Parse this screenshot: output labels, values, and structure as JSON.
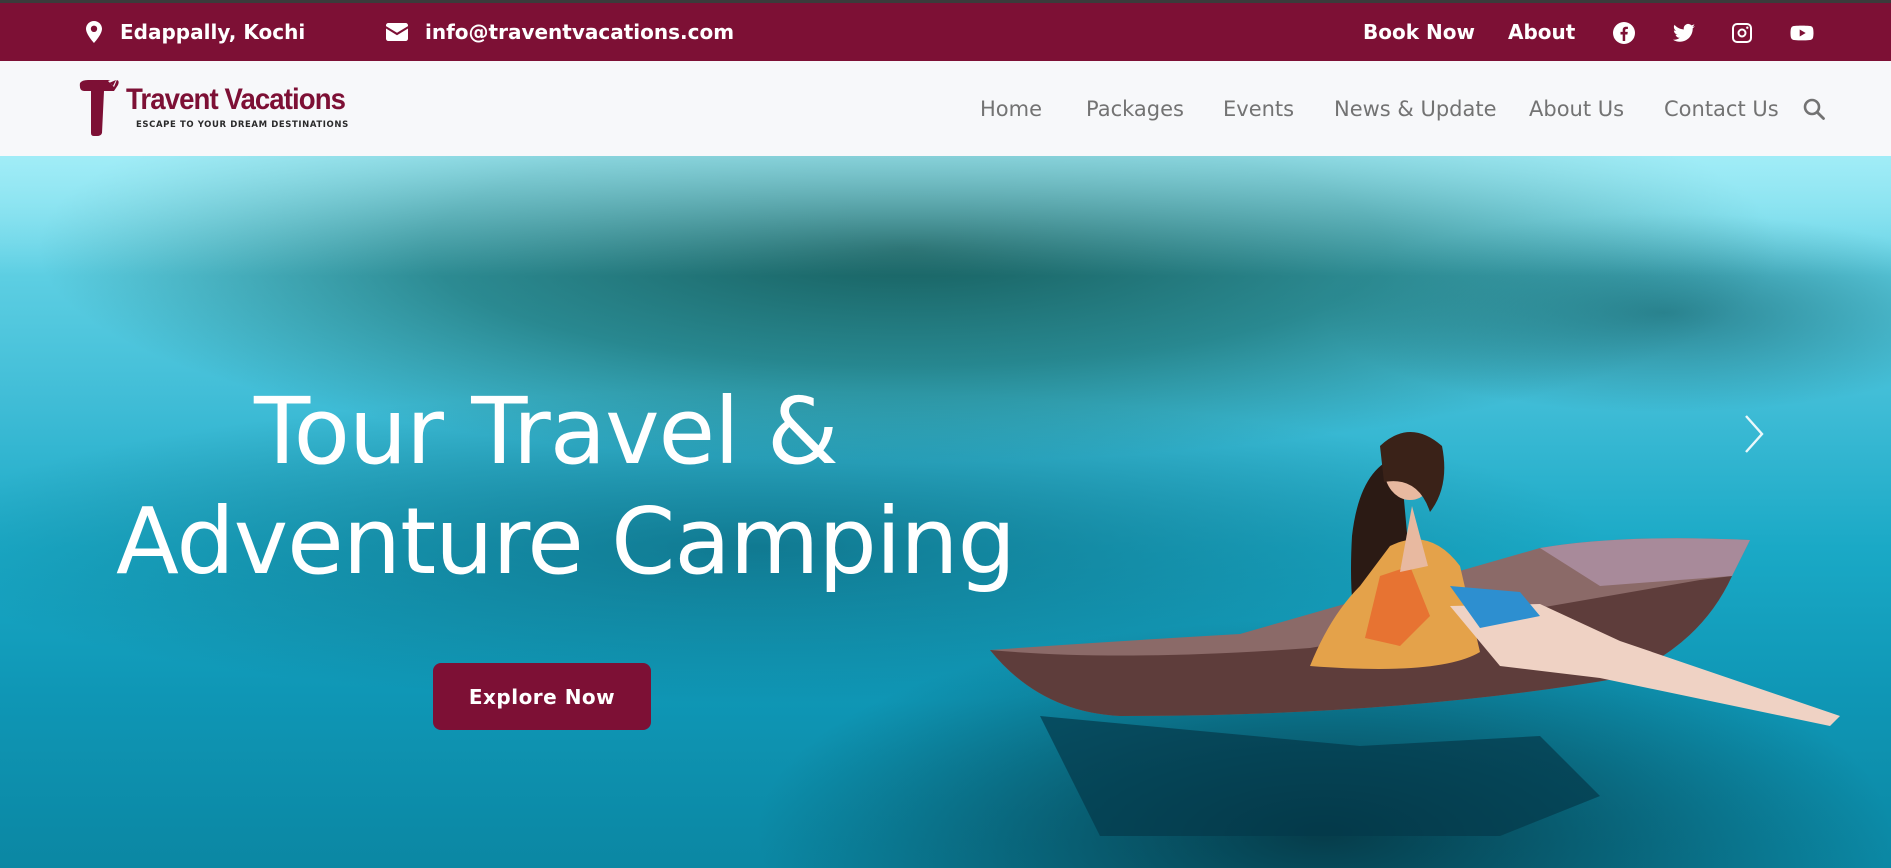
{
  "topbar": {
    "location": "Edappally, Kochi",
    "email": "info@traventvacations.com",
    "book_now": "Book Now",
    "about": "About",
    "social": [
      "facebook-icon",
      "twitter-icon",
      "instagram-icon",
      "youtube-icon"
    ]
  },
  "logo": {
    "name": "Travent Vacations",
    "tagline": "ESCAPE TO YOUR DREAM DESTINATIONS"
  },
  "nav": {
    "items": [
      "Home",
      "Packages",
      "Events",
      "News & Update",
      "About Us",
      "Contact Us"
    ]
  },
  "hero": {
    "title_line1": "Tour Travel &",
    "title_line2": "Adventure Camping",
    "cta": "Explore Now"
  },
  "colors": {
    "brand": "#7d1035",
    "nav_bg": "#f7f8fa",
    "nav_text": "#737373"
  }
}
